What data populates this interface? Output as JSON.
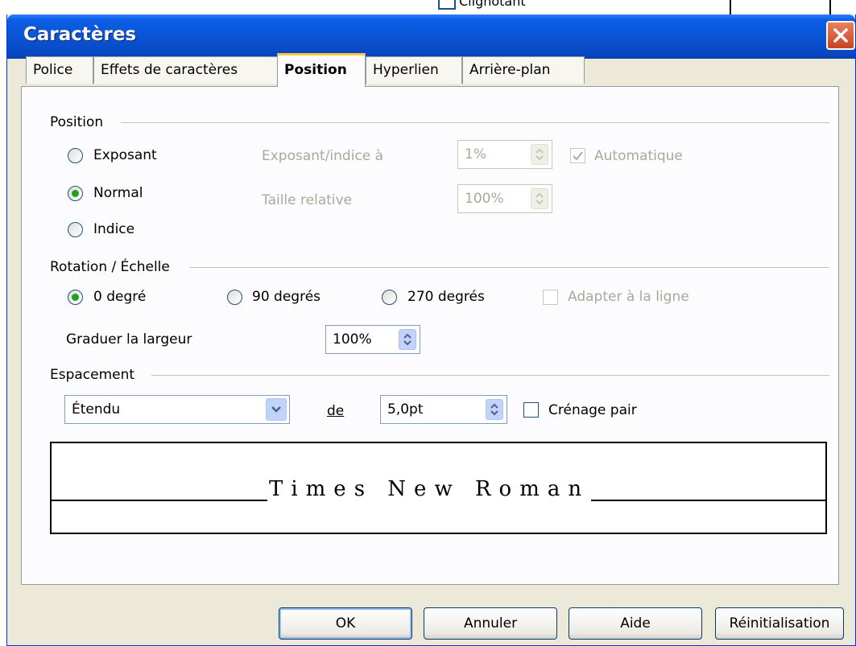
{
  "background": {
    "partial_label": "Clignotant"
  },
  "dialog": {
    "title": "Caractères",
    "tabs": [
      {
        "label": "Police"
      },
      {
        "label": "Effets de caractères"
      },
      {
        "label": "Position",
        "active": true
      },
      {
        "label": "Hyperlien"
      },
      {
        "label": "Arrière-plan"
      }
    ]
  },
  "position": {
    "section_title": "Position",
    "radio_exposant": "Exposant",
    "radio_normal": "Normal",
    "radio_indice": "Indice",
    "selected": "Normal",
    "raise_lower_label": "Exposant/indice à",
    "raise_lower_value": "1%",
    "relative_size_label": "Taille relative",
    "relative_size_value": "100%",
    "auto_label": "Automatique",
    "auto_checked": true
  },
  "rotation": {
    "section_title": "Rotation / Échelle",
    "radio_0": "0 degré",
    "radio_90": "90 degrés",
    "radio_270": "270 degrés",
    "selected": "0 degré",
    "fit_line_label": "Adapter à la ligne",
    "scale_width_label": "Graduer la largeur",
    "scale_width_value": "100%"
  },
  "spacing": {
    "section_title": "Espacement",
    "mode_value": "Étendu",
    "by_label": "de",
    "by_value": "5,0pt",
    "pair_kerning_label": "Crénage pair",
    "pair_kerning_checked": false
  },
  "preview": {
    "sample_text": "Times New Roman"
  },
  "buttons": {
    "ok": "OK",
    "cancel": "Annuler",
    "help": "Aide",
    "reset": "Réinitialisation"
  }
}
